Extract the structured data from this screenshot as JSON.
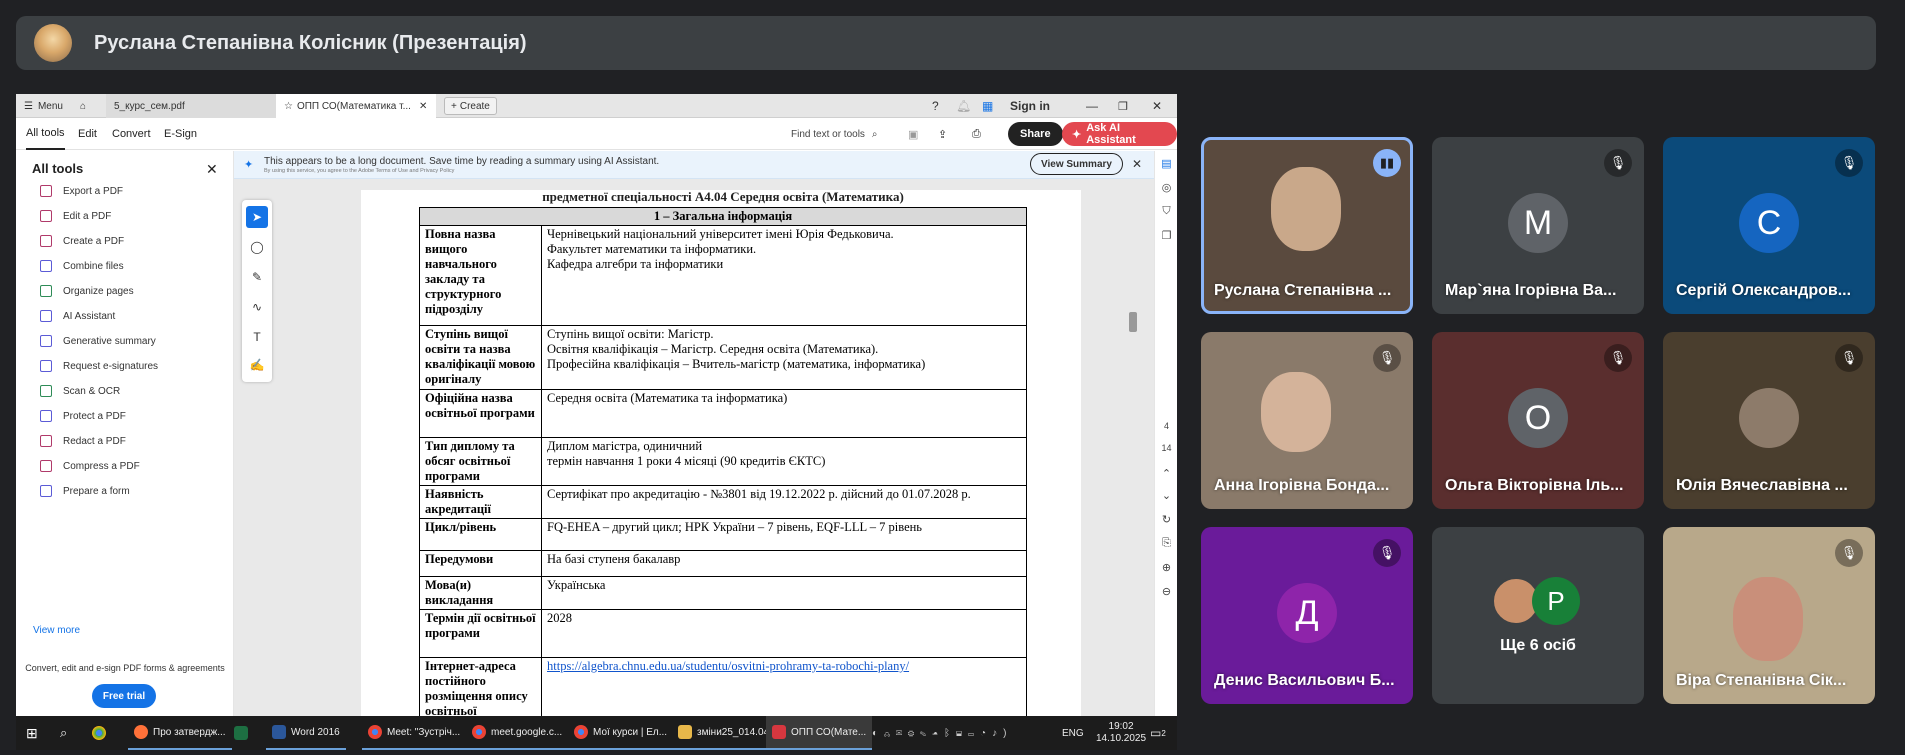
{
  "meeting": {
    "presenter_title": "Руслана Степанівна Колісник (Презентація)"
  },
  "browser": {
    "menu_label": "Menu",
    "tabs": [
      "5_курс_сем.pdf",
      "ОПП СО(Математика т...",
      "Create"
    ],
    "sign_in": "Sign in"
  },
  "acrobat": {
    "menus": [
      "All tools",
      "Edit",
      "Convert",
      "E-Sign"
    ],
    "find": "Find text or tools",
    "share": "Share",
    "ask_ai": "Ask AI Assistant",
    "banner_text": "This appears to be a long document. Save time by reading a summary using AI Assistant.",
    "banner_small": "By using this service, you agree to the Adobe Terms of Use and Privacy Policy",
    "view_summary": "View Summary",
    "sidebar_title": "All tools",
    "tools": [
      "Export a PDF",
      "Edit a PDF",
      "Create a PDF",
      "Combine files",
      "Organize pages",
      "AI Assistant",
      "Generative summary",
      "Request e-signatures",
      "Scan & OCR",
      "Protect a PDF",
      "Redact a PDF",
      "Compress a PDF",
      "Prepare a form"
    ],
    "view_more": "View more",
    "promo": "Convert, edit and e-sign PDF forms & agreements",
    "free_trial": "Free trial",
    "page_current": "4",
    "page_total": "14"
  },
  "document": {
    "title_line": "предметної спеціальності А4.04 Середня освіта (Математика)",
    "section_header": "1 – Загальна інформація",
    "rows": [
      {
        "label": "Повна назва вищого навчального закладу та структурного підрозділу",
        "value": "Чернівецький національний університет імені Юрія Федьковича.\nФакультет математики та інформатики.\nКафедра алгебри та інформатики"
      },
      {
        "label": "Ступінь вищої освіти та назва кваліфікації мовою оригіналу",
        "value": "Ступінь вищої освіти: Магістр.\nОсвітня кваліфікація – Магістр. Середня освіта (Математика).\nПрофесійна кваліфікація – Вчитель-магістр (математика, інформатика)"
      },
      {
        "label": "Офіційна назва освітньої програми",
        "value": "Середня освіта (Математика та інформатика)"
      },
      {
        "label": "Тип диплому та обсяг освітньої програми",
        "value": "Диплом магістра, одиничний\nтермін навчання 1 роки 4 місяці (90 кредитів ЄКТС)"
      },
      {
        "label": "Наявність акредитації",
        "value": "Сертифікат про акредитацію - №3801 від 19.12.2022 р. дійсний до 01.07.2028 р."
      },
      {
        "label": "Цикл/рівень",
        "value": "FQ-EHEA – другий цикл; НРК України – 7 рівень, EQF-LLL – 7 рівень"
      },
      {
        "label": "Передумови",
        "value": "На базі ступеня бакалавр"
      },
      {
        "label": "Мова(и) викладання",
        "value": "Українська"
      },
      {
        "label": "Термін дії освітньої програми",
        "value": "2028"
      }
    ],
    "url_label": "Інтернет-адреса постійного розміщення опису освітньої",
    "url_value": "https://algebra.chnu.edu.ua/studentu/osvitni-prohramy-ta-robochi-plany/"
  },
  "taskbar": {
    "apps": [
      "Про затвердж...",
      "Word 2016",
      "Meet: \"Зустріч...",
      "meet.google.c...",
      "Мої курси | Ел...",
      "зміни25_014.04",
      "ОПП СО(Мате..."
    ],
    "lang": "ENG",
    "time": "19:02",
    "date": "14.10.2025",
    "notif_count": "2"
  },
  "participants": [
    {
      "name": "Руслана Степанівна ...",
      "state": "speaking"
    },
    {
      "name": "Мар`яна Ігорівна Ва...",
      "letter": "М",
      "color": "#5f6368",
      "state": "muted"
    },
    {
      "name": "Сергій Олександров...",
      "letter": "С",
      "color": "#1565c0",
      "state": "muted"
    },
    {
      "name": "Анна Ігорівна Бонда...",
      "state": "muted"
    },
    {
      "name": "Ольга Вікторівна Іль...",
      "letter": "О",
      "color": "#5f6368",
      "state": "muted"
    },
    {
      "name": "Юлія Вячеславівна ...",
      "state": "muted"
    },
    {
      "name": "Денис Васильович Б...",
      "letter": "Д",
      "color": "#8e24aa",
      "state": "muted"
    },
    {
      "name": "Ще 6 осіб",
      "letter": "Р",
      "color": "#188038",
      "state": "group"
    },
    {
      "name": "Віра Степанівна Сік...",
      "state": "muted"
    }
  ],
  "colors": {
    "accent": "#1473e6",
    "meet_bg": "#202124",
    "tile_bg": "#3c4043",
    "ai_button": "#e34850"
  }
}
